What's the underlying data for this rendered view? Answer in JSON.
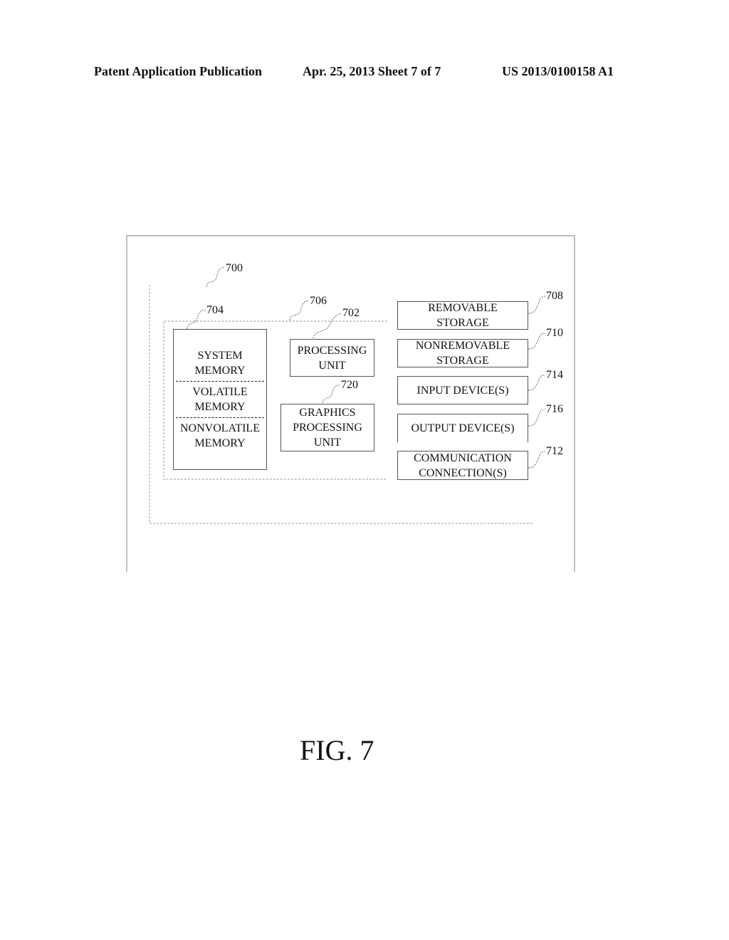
{
  "header": {
    "publication": "Patent Application Publication",
    "date_sheet": "Apr. 25, 2013  Sheet 7 of 7",
    "number": "US 2013/0100158 A1"
  },
  "diagram": {
    "refs": {
      "system": "700",
      "core": "706",
      "memory": "704",
      "processing": "702",
      "graphics": "720",
      "removable": "708",
      "nonremovable": "710",
      "input": "714",
      "output": "716",
      "communication": "712"
    },
    "memory_box": {
      "system_line1": "SYSTEM",
      "system_line2": "MEMORY",
      "volatile_line1": "VOLATILE",
      "volatile_line2": "MEMORY",
      "nonvolatile_line1": "NONVOLATILE",
      "nonvolatile_line2": "MEMORY"
    },
    "processing_unit": {
      "line1": "PROCESSING",
      "line2": "UNIT"
    },
    "graphics_unit": {
      "line1": "GRAPHICS",
      "line2": "PROCESSING",
      "line3": "UNIT"
    },
    "removable_storage": {
      "line1": "REMOVABLE",
      "line2": "STORAGE"
    },
    "nonremovable_storage": {
      "line1": "NONREMOVABLE",
      "line2": "STORAGE"
    },
    "input_devices": {
      "line1": "INPUT DEVICE(S)"
    },
    "output_devices": {
      "line1": "OUTPUT DEVICE(S)"
    },
    "communication": {
      "line1": "COMMUNICATION",
      "line2": "CONNECTION(S)"
    }
  },
  "figure_label": "FIG. 7"
}
